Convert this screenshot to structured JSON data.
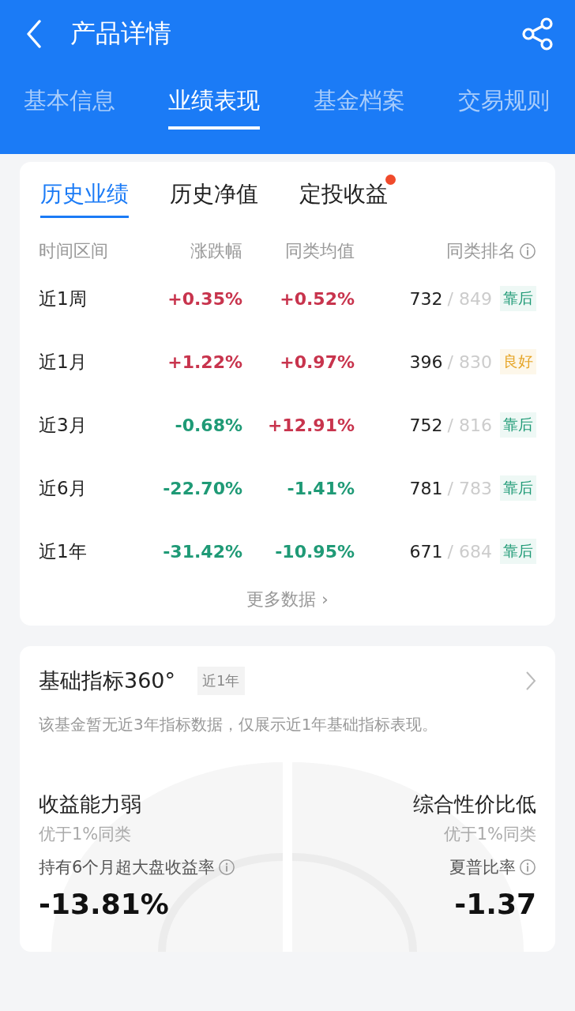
{
  "header": {
    "title": "产品详情"
  },
  "tabs": [
    {
      "label": "基本信息",
      "selected": false
    },
    {
      "label": "业绩表现",
      "selected": true
    },
    {
      "label": "基金档案",
      "selected": false
    },
    {
      "label": "交易规则",
      "selected": false
    }
  ],
  "performance": {
    "subtabs": [
      {
        "label": "历史业绩",
        "selected": true,
        "badge": false
      },
      {
        "label": "历史净值",
        "selected": false,
        "badge": false
      },
      {
        "label": "定投收益",
        "selected": false,
        "badge": true
      }
    ],
    "columns": [
      "时间区间",
      "涨跌幅",
      "同类均值",
      "同类排名"
    ],
    "rows": [
      {
        "period": "近1周",
        "change": {
          "text": "+0.35%",
          "color": "#c8344d"
        },
        "average": {
          "text": "+0.52%",
          "color": "#c8344d"
        },
        "rank": "732",
        "total": "/ 849",
        "tag": "靠后",
        "kind": "poor"
      },
      {
        "period": "近1月",
        "change": {
          "text": "+1.22%",
          "color": "#c8344d"
        },
        "average": {
          "text": "+0.97%",
          "color": "#c8344d"
        },
        "rank": "396",
        "total": "/ 830",
        "tag": "良好",
        "kind": "good"
      },
      {
        "period": "近3月",
        "change": {
          "text": "-0.68%",
          "color": "#1f9a76"
        },
        "average": {
          "text": "+12.91%",
          "color": "#c8344d"
        },
        "rank": "752",
        "total": "/ 816",
        "tag": "靠后",
        "kind": "poor"
      },
      {
        "period": "近6月",
        "change": {
          "text": "-22.70%",
          "color": "#1f9a76"
        },
        "average": {
          "text": "-1.41%",
          "color": "#1f9a76"
        },
        "rank": "781",
        "total": "/ 783",
        "tag": "靠后",
        "kind": "poor"
      },
      {
        "period": "近1年",
        "change": {
          "text": "-31.42%",
          "color": "#1f9a76"
        },
        "average": {
          "text": "-10.95%",
          "color": "#1f9a76"
        },
        "rank": "671",
        "total": "/ 684",
        "tag": "靠后",
        "kind": "poor"
      }
    ],
    "more": "更多数据 ›"
  },
  "indicators": {
    "title": "基础指标360°",
    "period": "近1年",
    "note": "该基金暂无近3年指标数据，仅展示近1年基础指标表现。",
    "metrics": [
      {
        "verdict": "收益能力弱",
        "compare": "优于1%同类",
        "label": "持有6个月超大盘收益率",
        "value": "-13.81%"
      },
      {
        "verdict": "综合性价比低",
        "compare": "优于1%同类",
        "label": "夏普比率",
        "value": "-1.37"
      }
    ]
  }
}
